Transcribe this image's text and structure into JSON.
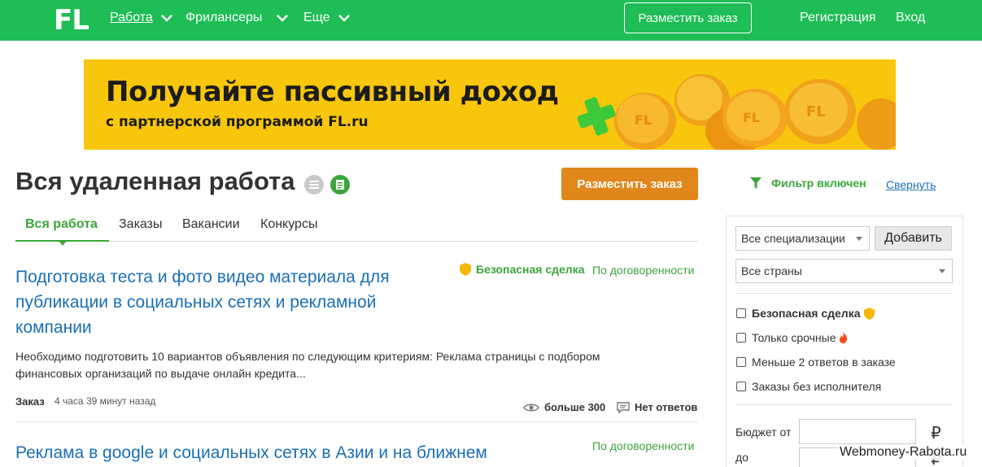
{
  "header": {
    "logo": "FL",
    "nav": [
      {
        "label": "Работа"
      },
      {
        "label": "Фрилансеры"
      },
      {
        "label": "Еще"
      }
    ],
    "post_order": "Разместить заказ",
    "register": "Регистрация",
    "login": "Вход",
    "bg_color": "#1fbd55"
  },
  "banner": {
    "headline": "Получайте пассивный доход",
    "subline": "с партнерской программой FL.ru",
    "bg_color": "#f8c60c"
  },
  "page": {
    "title": "Вся удаленная работа",
    "post_order": "Разместить заказ",
    "tabs": [
      "Вся работа",
      "Заказы",
      "Вакансии",
      "Конкурсы"
    ]
  },
  "listings": [
    {
      "title": "Подготовка теста и фото видео материала для публикации в социальных сетях и рекламной компании",
      "safe_deal": "Безопасная сделка",
      "price": "По договоренности",
      "description": "Необходимо подготовить 10 вариантов объявления по следующим критериям: Реклама страницы с подбором финансовых организаций по выдаче онлайн кредита...",
      "type": "Заказ",
      "time": "4 часа 39 минут назад",
      "views": "больше 300",
      "answers": "Нет ответов"
    },
    {
      "title": "Реклама в google и социальных сетях в Азии и на ближнем",
      "price": "По договоренности"
    }
  ],
  "filter": {
    "status": "Фильтр включен",
    "collapse": "Свернуть",
    "specializations": "Все специализации",
    "add": "Добавить",
    "countries": "Все страны",
    "checkboxes": [
      "Безопасная сделка",
      "Только срочные",
      "Меньше 2 ответов в заказе",
      "Заказы без исполнителя"
    ],
    "budget_from": "Бюджет от",
    "budget_to": "до",
    "currency": "₽"
  },
  "watermark": "Webmoney-Rabota.ru"
}
